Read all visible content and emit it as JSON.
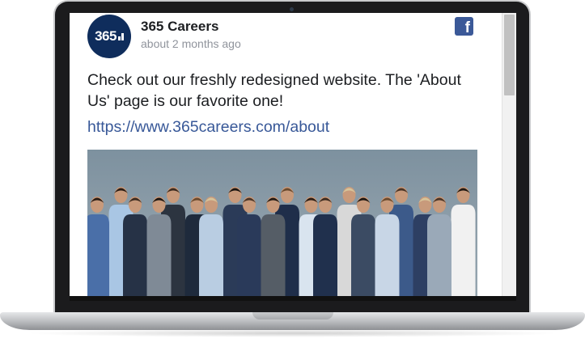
{
  "post": {
    "page_name": "365 Careers",
    "time": "about 2 months ago",
    "avatar_text": "365",
    "text": "Check out our freshly redesigned website. The 'About Us' page is our favorite one!",
    "link": "https://www.365careers.com/about",
    "social_icon": "facebook-icon",
    "photo": "team-group-photo"
  },
  "colors": {
    "brand_navy": "#0f2d5c",
    "facebook_blue": "#3b5998",
    "link_blue": "#385898"
  },
  "scrollbar": {
    "position": 0
  }
}
